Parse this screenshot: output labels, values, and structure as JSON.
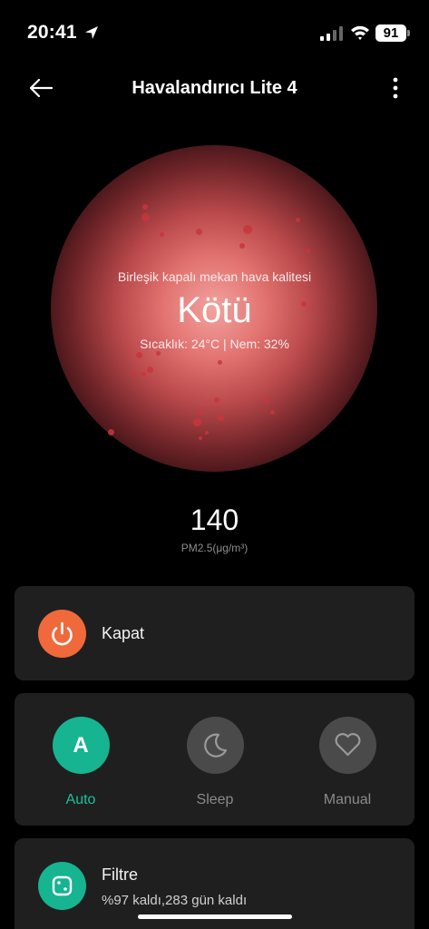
{
  "status_bar": {
    "time": "20:41",
    "battery": "91"
  },
  "header": {
    "title": "Havalandırıcı Lite 4"
  },
  "air_quality": {
    "caption": "Birleşik kapalı mekan hava kalitesi",
    "level": "Kötü",
    "conditions": "Sıcaklık: 24°C | Nem: 32%",
    "glow_color": "#e27370"
  },
  "pm": {
    "value": "140",
    "unit": "PM2.5(μg/m³)"
  },
  "power": {
    "label": "Kapat",
    "color": "#f0693b"
  },
  "modes": {
    "auto": {
      "label": "Auto",
      "glyph": "A"
    },
    "sleep": {
      "label": "Sleep"
    },
    "manual": {
      "label": "Manual"
    },
    "active_color": "#16b490"
  },
  "filter": {
    "title": "Filtre",
    "status": "%97 kaldı,283 gün kaldı"
  }
}
